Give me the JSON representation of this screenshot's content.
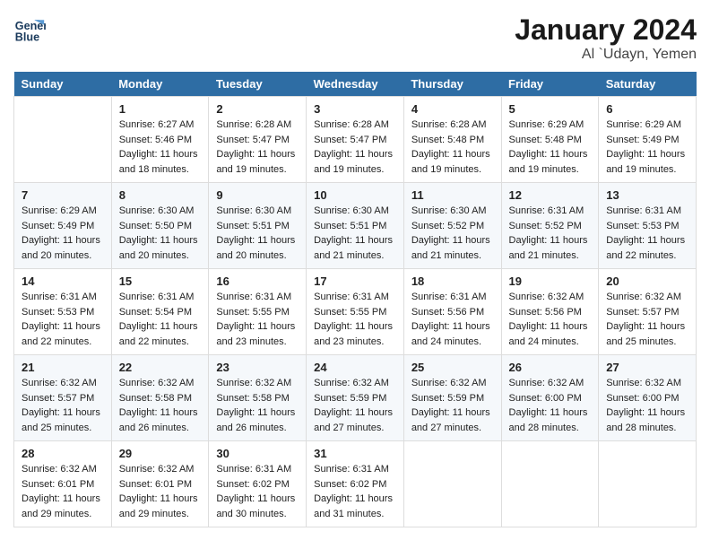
{
  "header": {
    "logo_line1": "General",
    "logo_line2": "Blue",
    "month": "January 2024",
    "location": "Al `Udayn, Yemen"
  },
  "days_of_week": [
    "Sunday",
    "Monday",
    "Tuesday",
    "Wednesday",
    "Thursday",
    "Friday",
    "Saturday"
  ],
  "weeks": [
    [
      {
        "num": "",
        "sunrise": "",
        "sunset": "",
        "daylight": ""
      },
      {
        "num": "1",
        "sunrise": "Sunrise: 6:27 AM",
        "sunset": "Sunset: 5:46 PM",
        "daylight": "Daylight: 11 hours and 18 minutes."
      },
      {
        "num": "2",
        "sunrise": "Sunrise: 6:28 AM",
        "sunset": "Sunset: 5:47 PM",
        "daylight": "Daylight: 11 hours and 19 minutes."
      },
      {
        "num": "3",
        "sunrise": "Sunrise: 6:28 AM",
        "sunset": "Sunset: 5:47 PM",
        "daylight": "Daylight: 11 hours and 19 minutes."
      },
      {
        "num": "4",
        "sunrise": "Sunrise: 6:28 AM",
        "sunset": "Sunset: 5:48 PM",
        "daylight": "Daylight: 11 hours and 19 minutes."
      },
      {
        "num": "5",
        "sunrise": "Sunrise: 6:29 AM",
        "sunset": "Sunset: 5:48 PM",
        "daylight": "Daylight: 11 hours and 19 minutes."
      },
      {
        "num": "6",
        "sunrise": "Sunrise: 6:29 AM",
        "sunset": "Sunset: 5:49 PM",
        "daylight": "Daylight: 11 hours and 19 minutes."
      }
    ],
    [
      {
        "num": "7",
        "sunrise": "Sunrise: 6:29 AM",
        "sunset": "Sunset: 5:49 PM",
        "daylight": "Daylight: 11 hours and 20 minutes."
      },
      {
        "num": "8",
        "sunrise": "Sunrise: 6:30 AM",
        "sunset": "Sunset: 5:50 PM",
        "daylight": "Daylight: 11 hours and 20 minutes."
      },
      {
        "num": "9",
        "sunrise": "Sunrise: 6:30 AM",
        "sunset": "Sunset: 5:51 PM",
        "daylight": "Daylight: 11 hours and 20 minutes."
      },
      {
        "num": "10",
        "sunrise": "Sunrise: 6:30 AM",
        "sunset": "Sunset: 5:51 PM",
        "daylight": "Daylight: 11 hours and 21 minutes."
      },
      {
        "num": "11",
        "sunrise": "Sunrise: 6:30 AM",
        "sunset": "Sunset: 5:52 PM",
        "daylight": "Daylight: 11 hours and 21 minutes."
      },
      {
        "num": "12",
        "sunrise": "Sunrise: 6:31 AM",
        "sunset": "Sunset: 5:52 PM",
        "daylight": "Daylight: 11 hours and 21 minutes."
      },
      {
        "num": "13",
        "sunrise": "Sunrise: 6:31 AM",
        "sunset": "Sunset: 5:53 PM",
        "daylight": "Daylight: 11 hours and 22 minutes."
      }
    ],
    [
      {
        "num": "14",
        "sunrise": "Sunrise: 6:31 AM",
        "sunset": "Sunset: 5:53 PM",
        "daylight": "Daylight: 11 hours and 22 minutes."
      },
      {
        "num": "15",
        "sunrise": "Sunrise: 6:31 AM",
        "sunset": "Sunset: 5:54 PM",
        "daylight": "Daylight: 11 hours and 22 minutes."
      },
      {
        "num": "16",
        "sunrise": "Sunrise: 6:31 AM",
        "sunset": "Sunset: 5:55 PM",
        "daylight": "Daylight: 11 hours and 23 minutes."
      },
      {
        "num": "17",
        "sunrise": "Sunrise: 6:31 AM",
        "sunset": "Sunset: 5:55 PM",
        "daylight": "Daylight: 11 hours and 23 minutes."
      },
      {
        "num": "18",
        "sunrise": "Sunrise: 6:31 AM",
        "sunset": "Sunset: 5:56 PM",
        "daylight": "Daylight: 11 hours and 24 minutes."
      },
      {
        "num": "19",
        "sunrise": "Sunrise: 6:32 AM",
        "sunset": "Sunset: 5:56 PM",
        "daylight": "Daylight: 11 hours and 24 minutes."
      },
      {
        "num": "20",
        "sunrise": "Sunrise: 6:32 AM",
        "sunset": "Sunset: 5:57 PM",
        "daylight": "Daylight: 11 hours and 25 minutes."
      }
    ],
    [
      {
        "num": "21",
        "sunrise": "Sunrise: 6:32 AM",
        "sunset": "Sunset: 5:57 PM",
        "daylight": "Daylight: 11 hours and 25 minutes."
      },
      {
        "num": "22",
        "sunrise": "Sunrise: 6:32 AM",
        "sunset": "Sunset: 5:58 PM",
        "daylight": "Daylight: 11 hours and 26 minutes."
      },
      {
        "num": "23",
        "sunrise": "Sunrise: 6:32 AM",
        "sunset": "Sunset: 5:58 PM",
        "daylight": "Daylight: 11 hours and 26 minutes."
      },
      {
        "num": "24",
        "sunrise": "Sunrise: 6:32 AM",
        "sunset": "Sunset: 5:59 PM",
        "daylight": "Daylight: 11 hours and 27 minutes."
      },
      {
        "num": "25",
        "sunrise": "Sunrise: 6:32 AM",
        "sunset": "Sunset: 5:59 PM",
        "daylight": "Daylight: 11 hours and 27 minutes."
      },
      {
        "num": "26",
        "sunrise": "Sunrise: 6:32 AM",
        "sunset": "Sunset: 6:00 PM",
        "daylight": "Daylight: 11 hours and 28 minutes."
      },
      {
        "num": "27",
        "sunrise": "Sunrise: 6:32 AM",
        "sunset": "Sunset: 6:00 PM",
        "daylight": "Daylight: 11 hours and 28 minutes."
      }
    ],
    [
      {
        "num": "28",
        "sunrise": "Sunrise: 6:32 AM",
        "sunset": "Sunset: 6:01 PM",
        "daylight": "Daylight: 11 hours and 29 minutes."
      },
      {
        "num": "29",
        "sunrise": "Sunrise: 6:32 AM",
        "sunset": "Sunset: 6:01 PM",
        "daylight": "Daylight: 11 hours and 29 minutes."
      },
      {
        "num": "30",
        "sunrise": "Sunrise: 6:31 AM",
        "sunset": "Sunset: 6:02 PM",
        "daylight": "Daylight: 11 hours and 30 minutes."
      },
      {
        "num": "31",
        "sunrise": "Sunrise: 6:31 AM",
        "sunset": "Sunset: 6:02 PM",
        "daylight": "Daylight: 11 hours and 31 minutes."
      },
      {
        "num": "",
        "sunrise": "",
        "sunset": "",
        "daylight": ""
      },
      {
        "num": "",
        "sunrise": "",
        "sunset": "",
        "daylight": ""
      },
      {
        "num": "",
        "sunrise": "",
        "sunset": "",
        "daylight": ""
      }
    ]
  ]
}
